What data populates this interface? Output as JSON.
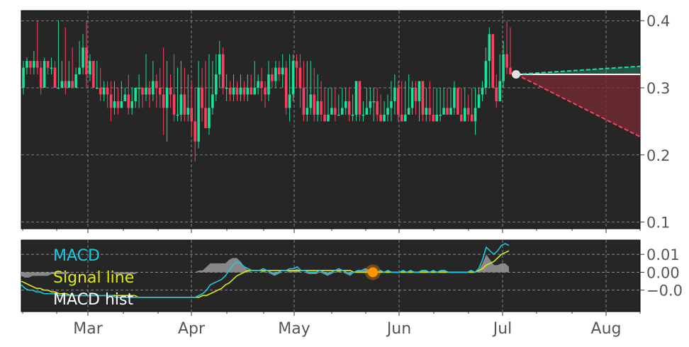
{
  "chart_data": [
    {
      "type": "candlestick",
      "x_labels": [
        "Mar",
        "Apr",
        "May",
        "Jun",
        "Jul",
        "Aug"
      ],
      "ylim": [
        0.09,
        0.415
      ],
      "yticks": [
        0.1,
        0.2,
        0.3,
        0.4
      ],
      "ytick_labels": [
        "0.1",
        "0.2",
        "0.3",
        "0.4"
      ],
      "grid": true,
      "colors": {
        "up": "#19e39a",
        "down": "#ff3f5f",
        "bg": "#262626"
      },
      "last_close": 0.32,
      "projection": {
        "start": 0.32,
        "upper_end": 0.332,
        "lower_end": 0.227,
        "flat": 0.32,
        "upper_color": "#19e39a",
        "lower_color": "#ff3f5f"
      },
      "candles": [
        [
          0.3,
          0.34,
          0.33,
          0.29
        ],
        [
          0.33,
          0.345,
          0.34,
          0.32
        ],
        [
          0.34,
          0.34,
          0.33,
          0.32
        ],
        [
          0.33,
          0.355,
          0.34,
          0.32
        ],
        [
          0.34,
          0.4,
          0.33,
          0.32
        ],
        [
          0.33,
          0.34,
          0.3,
          0.29
        ],
        [
          0.3,
          0.345,
          0.34,
          0.3
        ],
        [
          0.34,
          0.34,
          0.33,
          0.32
        ],
        [
          0.33,
          0.345,
          0.33,
          0.32
        ],
        [
          0.33,
          0.34,
          0.3,
          0.3
        ],
        [
          0.3,
          0.4,
          0.3,
          0.3
        ],
        [
          0.3,
          0.34,
          0.31,
          0.3
        ],
        [
          0.31,
          0.39,
          0.3,
          0.29
        ],
        [
          0.3,
          0.34,
          0.31,
          0.3
        ],
        [
          0.31,
          0.36,
          0.3,
          0.3
        ],
        [
          0.3,
          0.33,
          0.32,
          0.3
        ],
        [
          0.32,
          0.37,
          0.33,
          0.32
        ],
        [
          0.33,
          0.38,
          0.36,
          0.32
        ],
        [
          0.36,
          0.4,
          0.32,
          0.3
        ],
        [
          0.32,
          0.35,
          0.34,
          0.31
        ],
        [
          0.34,
          0.34,
          0.3,
          0.3
        ],
        [
          0.3,
          0.34,
          0.3,
          0.3
        ],
        [
          0.3,
          0.33,
          0.29,
          0.28
        ],
        [
          0.29,
          0.31,
          0.3,
          0.28
        ],
        [
          0.3,
          0.31,
          0.29,
          0.27
        ],
        [
          0.29,
          0.31,
          0.27,
          0.25
        ],
        [
          0.27,
          0.31,
          0.28,
          0.26
        ],
        [
          0.28,
          0.3,
          0.27,
          0.26
        ],
        [
          0.27,
          0.31,
          0.28,
          0.27
        ],
        [
          0.28,
          0.3,
          0.29,
          0.28
        ],
        [
          0.29,
          0.32,
          0.27,
          0.26
        ],
        [
          0.27,
          0.3,
          0.28,
          0.26
        ],
        [
          0.28,
          0.3,
          0.3,
          0.27
        ],
        [
          0.3,
          0.32,
          0.3,
          0.27
        ],
        [
          0.3,
          0.3,
          0.29,
          0.27
        ],
        [
          0.29,
          0.35,
          0.3,
          0.28
        ],
        [
          0.3,
          0.31,
          0.29,
          0.27
        ],
        [
          0.29,
          0.34,
          0.31,
          0.28
        ],
        [
          0.31,
          0.32,
          0.3,
          0.27
        ],
        [
          0.3,
          0.33,
          0.29,
          0.27
        ],
        [
          0.29,
          0.36,
          0.27,
          0.23
        ],
        [
          0.27,
          0.34,
          0.3,
          0.22
        ],
        [
          0.3,
          0.32,
          0.29,
          0.27
        ],
        [
          0.29,
          0.35,
          0.26,
          0.25
        ],
        [
          0.26,
          0.33,
          0.26,
          0.25
        ],
        [
          0.26,
          0.34,
          0.29,
          0.25
        ],
        [
          0.29,
          0.33,
          0.26,
          0.25
        ],
        [
          0.26,
          0.32,
          0.27,
          0.25
        ],
        [
          0.27,
          0.31,
          0.25,
          0.23
        ],
        [
          0.25,
          0.3,
          0.22,
          0.19
        ],
        [
          0.22,
          0.34,
          0.3,
          0.21
        ],
        [
          0.3,
          0.33,
          0.27,
          0.25
        ],
        [
          0.27,
          0.34,
          0.24,
          0.24
        ],
        [
          0.24,
          0.35,
          0.27,
          0.23
        ],
        [
          0.27,
          0.34,
          0.29,
          0.26
        ],
        [
          0.29,
          0.35,
          0.32,
          0.28
        ],
        [
          0.32,
          0.37,
          0.35,
          0.3
        ],
        [
          0.35,
          0.36,
          0.3,
          0.29
        ],
        [
          0.3,
          0.32,
          0.3,
          0.28
        ],
        [
          0.3,
          0.31,
          0.29,
          0.28
        ],
        [
          0.29,
          0.32,
          0.3,
          0.28
        ],
        [
          0.3,
          0.31,
          0.29,
          0.28
        ],
        [
          0.29,
          0.32,
          0.3,
          0.28
        ],
        [
          0.3,
          0.31,
          0.29,
          0.28
        ],
        [
          0.29,
          0.32,
          0.3,
          0.28
        ],
        [
          0.3,
          0.32,
          0.29,
          0.29
        ],
        [
          0.29,
          0.34,
          0.3,
          0.29
        ],
        [
          0.3,
          0.32,
          0.31,
          0.29
        ],
        [
          0.31,
          0.33,
          0.3,
          0.28
        ],
        [
          0.3,
          0.31,
          0.29,
          0.27
        ],
        [
          0.29,
          0.34,
          0.32,
          0.28
        ],
        [
          0.32,
          0.33,
          0.31,
          0.3
        ],
        [
          0.31,
          0.34,
          0.33,
          0.3
        ],
        [
          0.33,
          0.34,
          0.32,
          0.31
        ],
        [
          0.32,
          0.35,
          0.33,
          0.3
        ],
        [
          0.33,
          0.34,
          0.27,
          0.26
        ],
        [
          0.27,
          0.35,
          0.29,
          0.25
        ],
        [
          0.29,
          0.35,
          0.34,
          0.28
        ],
        [
          0.34,
          0.35,
          0.33,
          0.3
        ],
        [
          0.33,
          0.35,
          0.3,
          0.27
        ],
        [
          0.3,
          0.34,
          0.26,
          0.25
        ],
        [
          0.26,
          0.34,
          0.27,
          0.25
        ],
        [
          0.27,
          0.34,
          0.29,
          0.26
        ],
        [
          0.29,
          0.33,
          0.26,
          0.25
        ],
        [
          0.26,
          0.32,
          0.28,
          0.25
        ],
        [
          0.28,
          0.31,
          0.26,
          0.25
        ],
        [
          0.26,
          0.3,
          0.25,
          0.25
        ],
        [
          0.25,
          0.3,
          0.26,
          0.25
        ],
        [
          0.26,
          0.3,
          0.27,
          0.26
        ],
        [
          0.27,
          0.3,
          0.26,
          0.25
        ],
        [
          0.26,
          0.29,
          0.26,
          0.26
        ],
        [
          0.26,
          0.3,
          0.27,
          0.26
        ],
        [
          0.27,
          0.3,
          0.28,
          0.26
        ],
        [
          0.28,
          0.3,
          0.26,
          0.25
        ],
        [
          0.26,
          0.29,
          0.26,
          0.25
        ],
        [
          0.26,
          0.31,
          0.31,
          0.25
        ],
        [
          0.31,
          0.31,
          0.26,
          0.25
        ],
        [
          0.26,
          0.28,
          0.26,
          0.25
        ],
        [
          0.26,
          0.3,
          0.27,
          0.26
        ],
        [
          0.27,
          0.3,
          0.28,
          0.26
        ],
        [
          0.28,
          0.3,
          0.28,
          0.25
        ],
        [
          0.28,
          0.3,
          0.26,
          0.25
        ],
        [
          0.26,
          0.29,
          0.25,
          0.25
        ],
        [
          0.25,
          0.28,
          0.26,
          0.25
        ],
        [
          0.26,
          0.29,
          0.27,
          0.25
        ],
        [
          0.27,
          0.31,
          0.28,
          0.25
        ],
        [
          0.28,
          0.32,
          0.3,
          0.26
        ],
        [
          0.3,
          0.31,
          0.26,
          0.25
        ],
        [
          0.26,
          0.31,
          0.25,
          0.25
        ],
        [
          0.25,
          0.31,
          0.26,
          0.25
        ],
        [
          0.26,
          0.32,
          0.27,
          0.26
        ],
        [
          0.27,
          0.31,
          0.3,
          0.26
        ],
        [
          0.3,
          0.31,
          0.28,
          0.26
        ],
        [
          0.28,
          0.31,
          0.31,
          0.25
        ],
        [
          0.31,
          0.31,
          0.26,
          0.25
        ],
        [
          0.26,
          0.3,
          0.27,
          0.25
        ],
        [
          0.27,
          0.31,
          0.26,
          0.25
        ],
        [
          0.26,
          0.3,
          0.25,
          0.25
        ],
        [
          0.25,
          0.3,
          0.26,
          0.25
        ],
        [
          0.26,
          0.3,
          0.26,
          0.25
        ],
        [
          0.26,
          0.3,
          0.27,
          0.26
        ],
        [
          0.27,
          0.3,
          0.26,
          0.26
        ],
        [
          0.26,
          0.3,
          0.27,
          0.26
        ],
        [
          0.27,
          0.31,
          0.3,
          0.26
        ],
        [
          0.3,
          0.3,
          0.26,
          0.26
        ],
        [
          0.26,
          0.3,
          0.25,
          0.25
        ],
        [
          0.25,
          0.3,
          0.27,
          0.25
        ],
        [
          0.27,
          0.29,
          0.26,
          0.25
        ],
        [
          0.26,
          0.3,
          0.25,
          0.25
        ],
        [
          0.25,
          0.3,
          0.27,
          0.23
        ],
        [
          0.27,
          0.3,
          0.29,
          0.27
        ],
        [
          0.29,
          0.31,
          0.3,
          0.28
        ],
        [
          0.3,
          0.36,
          0.34,
          0.29
        ],
        [
          0.34,
          0.39,
          0.38,
          0.3
        ],
        [
          0.38,
          0.38,
          0.3,
          0.3
        ],
        [
          0.3,
          0.32,
          0.28,
          0.27
        ],
        [
          0.28,
          0.35,
          0.31,
          0.28
        ],
        [
          0.31,
          0.37,
          0.35,
          0.3
        ],
        [
          0.35,
          0.4,
          0.33,
          0.32
        ],
        [
          0.33,
          0.39,
          0.32,
          0.32
        ]
      ]
    },
    {
      "type": "line",
      "title_legend": [
        "MACD",
        "Signal line",
        "MACD hist"
      ],
      "ylim": [
        -0.022,
        0.018
      ],
      "yticks": [
        0.01,
        0.0,
        -0.01
      ],
      "ytick_labels": [
        "0.01",
        "0.00",
        "−0.0"
      ],
      "colors": {
        "macd": "#1ec8e0",
        "signal": "#e0e814",
        "hist": "#9a9a9a",
        "marker": "#ff9500"
      },
      "marker": {
        "index": 93,
        "value": 0.0
      },
      "macd": [
        -0.007,
        -0.009,
        -0.01,
        -0.01,
        -0.011,
        -0.011,
        -0.012,
        -0.012,
        -0.012,
        -0.012,
        -0.013,
        -0.013,
        -0.013,
        -0.013,
        -0.013,
        -0.013,
        -0.013,
        -0.013,
        -0.013,
        -0.013,
        -0.013,
        -0.013,
        -0.013,
        -0.013,
        -0.013,
        -0.014,
        -0.014,
        -0.014,
        -0.014,
        -0.014,
        -0.014,
        -0.014,
        -0.014,
        -0.014,
        -0.014,
        -0.014,
        -0.014,
        -0.014,
        -0.014,
        -0.014,
        -0.014,
        -0.014,
        -0.014,
        -0.014,
        -0.014,
        -0.014,
        -0.014,
        -0.013,
        -0.012,
        -0.01,
        -0.007,
        -0.006,
        -0.005,
        -0.004,
        -0.002,
        0.001,
        0.004,
        0.006,
        0.005,
        0.003,
        0.002,
        0.001,
        0.001,
        0.001,
        0.002,
        0.001,
        0.0,
        -0.001,
        0.0,
        0.001,
        0.001,
        0.002,
        0.002,
        0.003,
        0.001,
        0.001,
        0.0,
        0.0,
        0.0,
        0.001,
        0.0,
        -0.001,
        0.0,
        0.001,
        0.002,
        0.001,
        0.0,
        -0.001,
        0.0,
        0.001,
        0.001,
        0.002,
        0.001,
        0.0,
        0.0,
        0.001,
        0.0,
        0.001,
        0.0,
        0.0,
        0.0,
        0.001,
        0.0,
        0.001,
        0.0,
        0.0,
        0.001,
        0.001,
        0.0,
        0.001,
        0.0,
        0.001,
        0.001,
        0.0,
        0.0,
        0.0,
        0.0,
        0.0,
        0.0,
        0.001,
        0.0,
        0.002,
        0.007,
        0.014,
        0.012,
        0.01,
        0.012,
        0.015,
        0.016,
        0.015
      ],
      "signal": [
        -0.005,
        -0.006,
        -0.007,
        -0.008,
        -0.009,
        -0.009,
        -0.01,
        -0.01,
        -0.011,
        -0.011,
        -0.012,
        -0.012,
        -0.012,
        -0.013,
        -0.013,
        -0.013,
        -0.013,
        -0.013,
        -0.013,
        -0.013,
        -0.013,
        -0.013,
        -0.013,
        -0.013,
        -0.013,
        -0.013,
        -0.013,
        -0.013,
        -0.013,
        -0.013,
        -0.013,
        -0.014,
        -0.014,
        -0.014,
        -0.014,
        -0.014,
        -0.014,
        -0.014,
        -0.014,
        -0.014,
        -0.014,
        -0.014,
        -0.014,
        -0.014,
        -0.014,
        -0.014,
        -0.014,
        -0.014,
        -0.013,
        -0.013,
        -0.012,
        -0.011,
        -0.01,
        -0.009,
        -0.007,
        -0.006,
        -0.004,
        -0.002,
        -0.001,
        0.0,
        0.001,
        0.001,
        0.001,
        0.001,
        0.001,
        0.001,
        0.001,
        0.001,
        0.001,
        0.001,
        0.001,
        0.001,
        0.001,
        0.001,
        0.001,
        0.001,
        0.001,
        0.001,
        0.001,
        0.001,
        0.001,
        0.001,
        0.001,
        0.001,
        0.001,
        0.001,
        0.001,
        0.001,
        0.0,
        0.0,
        0.0,
        0.0,
        0.0,
        0.0,
        0.0,
        0.0,
        0.0,
        0.0,
        0.0,
        0.0,
        0.0,
        0.0,
        0.0,
        0.0,
        0.0,
        0.0,
        0.0,
        0.0,
        0.0,
        0.0,
        0.0,
        0.0,
        0.0,
        0.0,
        0.0,
        0.0,
        0.0,
        0.0,
        0.0,
        0.0,
        0.0,
        0.001,
        0.002,
        0.004,
        0.005,
        0.006,
        0.008,
        0.01,
        0.011,
        0.012
      ]
    }
  ]
}
